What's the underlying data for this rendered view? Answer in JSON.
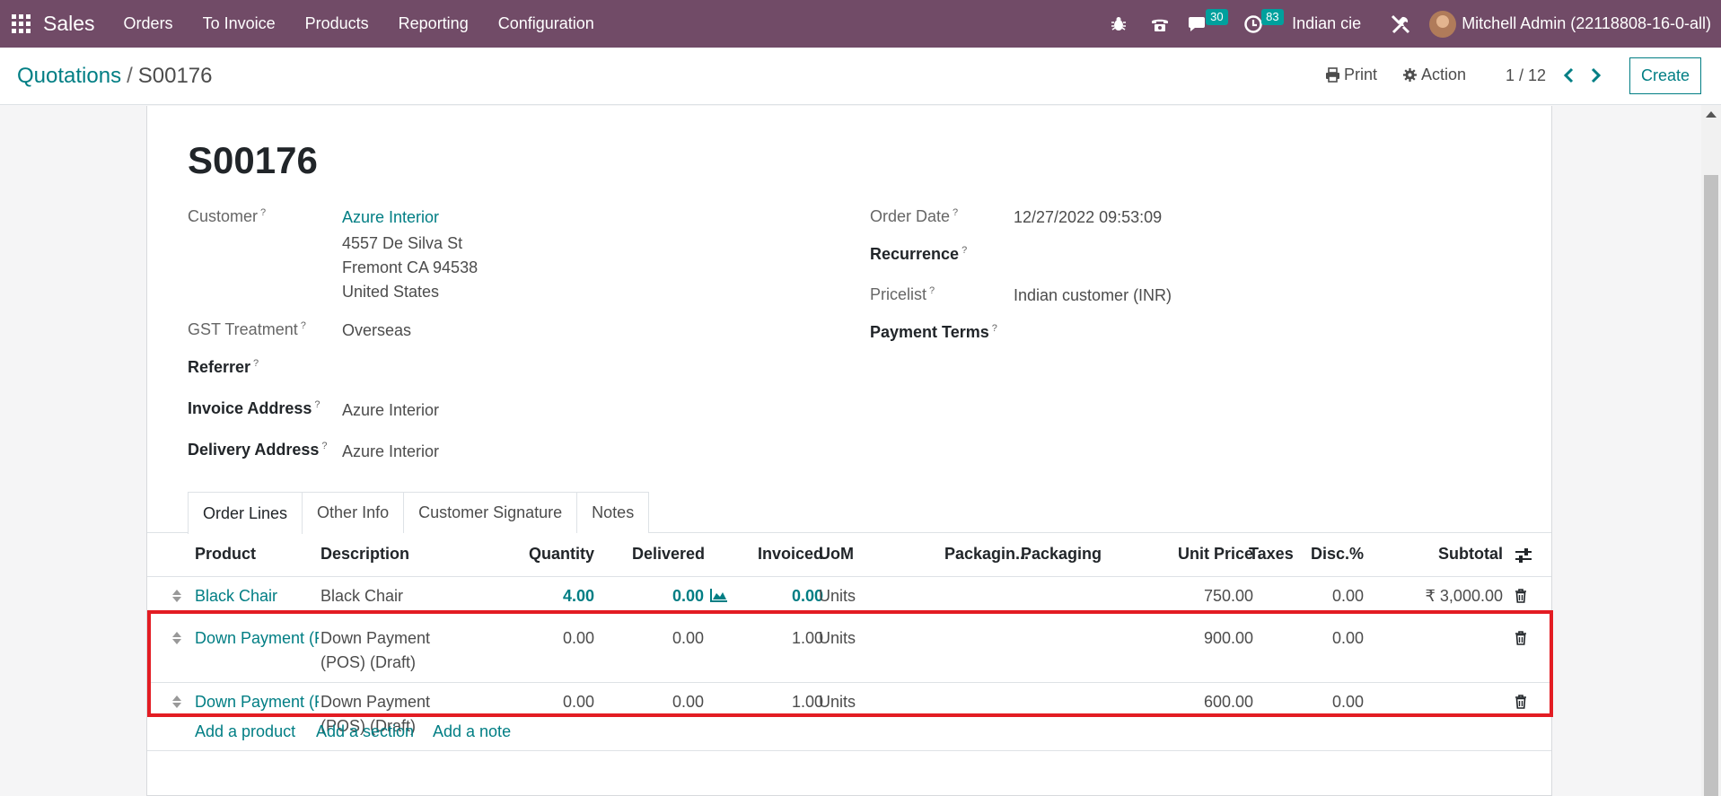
{
  "navbar": {
    "brand": "Sales",
    "menu": [
      "Orders",
      "To Invoice",
      "Products",
      "Reporting",
      "Configuration"
    ],
    "messages_count": "30",
    "activities_count": "83",
    "company": "Indian cie",
    "user": "Mitchell Admin (22118808-16-0-all)"
  },
  "control": {
    "breadcrumb_parent": "Quotations",
    "breadcrumb_sep": "/",
    "breadcrumb_current": "S00176",
    "print_label": "Print",
    "action_label": "Action",
    "pager": "1 / 12",
    "create_label": "Create"
  },
  "form": {
    "title": "S00176",
    "customer_label": "Customer",
    "customer_name": "Azure Interior",
    "address_line1": "4557 De Silva St",
    "address_line2": "Fremont CA 94538",
    "address_line3": "United States",
    "gst_label": "GST Treatment",
    "gst_value": "Overseas",
    "referrer_label": "Referrer",
    "invoice_address_label": "Invoice Address",
    "invoice_address_value": "Azure Interior",
    "delivery_address_label": "Delivery Address",
    "delivery_address_value": "Azure Interior",
    "order_date_label": "Order Date",
    "order_date_value": "12/27/2022 09:53:09",
    "recurrence_label": "Recurrence",
    "pricelist_label": "Pricelist",
    "pricelist_value": "Indian customer (INR)",
    "payment_terms_label": "Payment Terms",
    "help_mark": "?"
  },
  "tabs": [
    "Order Lines",
    "Other Info",
    "Customer Signature",
    "Notes"
  ],
  "table": {
    "headers": {
      "product": "Product",
      "description": "Description",
      "quantity": "Quantity",
      "delivered": "Delivered",
      "invoiced": "Invoiced",
      "uom": "UoM",
      "packaging_qty": "Packagin...",
      "packaging": "Packaging",
      "unit_price": "Unit Price",
      "taxes": "Taxes",
      "discount": "Disc.%",
      "subtotal": "Subtotal"
    },
    "rows": [
      {
        "product": "Black Chair",
        "description1": "Black Chair",
        "description2": "",
        "quantity": "4.00",
        "delivered": "0.00",
        "invoiced": "0.00",
        "uom": "Units",
        "unit_price": "750.00",
        "discount": "0.00",
        "subtotal": "₹ 3,000.00"
      },
      {
        "product": "Down Payment (F",
        "description1": "Down Payment",
        "description2": "(POS) (Draft)",
        "quantity": "0.00",
        "delivered": "0.00",
        "invoiced": "1.00",
        "uom": "Units",
        "unit_price": "900.00",
        "discount": "0.00",
        "subtotal": ""
      },
      {
        "product": "Down Payment (F",
        "description1": "Down Payment",
        "description2": "(POS) (Draft)",
        "quantity": "0.00",
        "delivered": "0.00",
        "invoiced": "1.00",
        "uom": "Units",
        "unit_price": "600.00",
        "discount": "0.00",
        "subtotal": ""
      }
    ],
    "add_product": "Add a product",
    "add_section": "Add a section",
    "add_note": "Add a note"
  }
}
